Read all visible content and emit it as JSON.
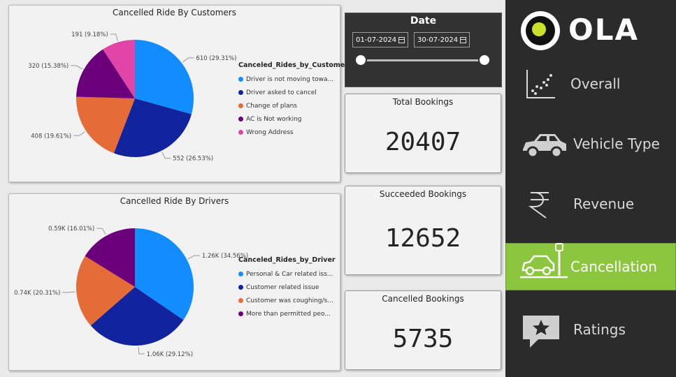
{
  "brand": {
    "logo_text": "OLA",
    "accent": "#8cc63f",
    "logo_dot": "#c8e02b"
  },
  "date_filter": {
    "title": "Date",
    "start": "01-07-2024",
    "end": "30-07-2024"
  },
  "kpis": [
    {
      "label": "Total Bookings",
      "value": "20407"
    },
    {
      "label": "Succeeded Bookings",
      "value": "12652"
    },
    {
      "label": "Cancelled Bookings",
      "value": "5735"
    }
  ],
  "nav": [
    {
      "label": "Overall",
      "icon": "scatter-chart-icon",
      "active": false
    },
    {
      "label": "Vehicle Type",
      "icon": "car-icon",
      "active": false
    },
    {
      "label": "Revenue",
      "icon": "rupee-icon",
      "active": false
    },
    {
      "label": "Cancellation",
      "icon": "car-cancellation-icon",
      "active": true
    },
    {
      "label": "Ratings",
      "icon": "star-comment-icon",
      "active": false
    }
  ],
  "chart_data": [
    {
      "type": "pie",
      "title": "Cancelled Ride By Customers",
      "legend_title": "Canceled_Rides_by_Customer",
      "legend_position": "right",
      "series": [
        {
          "name": "Driver is not moving towa...",
          "value": 610,
          "label": "610 (29.31%)",
          "color": "#118DFF"
        },
        {
          "name": "Driver asked to cancel",
          "value": 552,
          "label": "552 (26.53%)",
          "color": "#12239E"
        },
        {
          "name": "Change of plans",
          "value": 408,
          "label": "408 (19.61%)",
          "color": "#E66C37"
        },
        {
          "name": "AC is Not working",
          "value": 320,
          "label": "320 (15.38%)",
          "color": "#6B007B"
        },
        {
          "name": "Wrong Address",
          "value": 191,
          "label": "191 (9.18%)",
          "color": "#E044A7"
        }
      ]
    },
    {
      "type": "pie",
      "title": "Cancelled Ride By Drivers",
      "legend_title": "Canceled_Rides_by_Driver",
      "legend_position": "right",
      "series": [
        {
          "name": "Personal & Car related iss...",
          "value": 1260,
          "label": "1.26K (34.56%)",
          "color": "#118DFF"
        },
        {
          "name": "Customer related issue",
          "value": 1060,
          "label": "1.06K (29.12%)",
          "color": "#12239E"
        },
        {
          "name": "Customer was coughing/s...",
          "value": 740,
          "label": "0.74K (20.31%)",
          "color": "#E66C37"
        },
        {
          "name": "More than permitted peo...",
          "value": 590,
          "label": "0.59K (16.01%)",
          "color": "#6B007B"
        }
      ]
    }
  ]
}
